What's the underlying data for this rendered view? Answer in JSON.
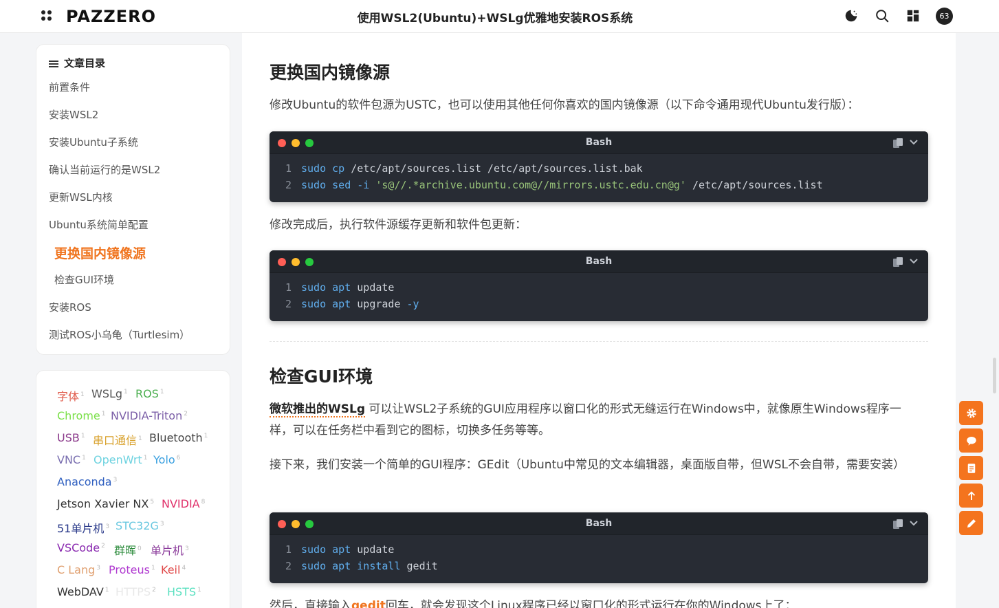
{
  "header": {
    "logo": "PAZZERO",
    "title": "使用WSL2(Ubuntu)+WSLg优雅地安装ROS系统",
    "avatar_text": "63"
  },
  "toc": {
    "title": "文章目录",
    "items": [
      {
        "label": "前置条件"
      },
      {
        "label": "安装WSL2"
      },
      {
        "label": "安装Ubuntu子系统"
      },
      {
        "label": "确认当前运行的是WSL2"
      },
      {
        "label": "更新WSL内核"
      },
      {
        "label": "Ubuntu系统简单配置"
      },
      {
        "label": "更换国内镜像源"
      },
      {
        "label": "检查GUI环境"
      },
      {
        "label": "安装ROS"
      },
      {
        "label": "测试ROS小乌龟（Turtlesim）"
      }
    ]
  },
  "tags": [
    {
      "name": "字体",
      "count": "1",
      "color": "#e05a4a"
    },
    {
      "name": "WSLg",
      "count": "1",
      "color": "#555555"
    },
    {
      "name": "ROS",
      "count": "1",
      "color": "#4caf50"
    },
    {
      "name": "Chrome",
      "count": "1",
      "color": "#7be04a"
    },
    {
      "name": "NVIDIA-Triton",
      "count": "2",
      "color": "#7b5ea7"
    },
    {
      "name": "USB",
      "count": "1",
      "color": "#8b3a8b"
    },
    {
      "name": "串口通信",
      "count": "1",
      "color": "#d8a02a"
    },
    {
      "name": "Bluetooth",
      "count": "1",
      "color": "#444444"
    },
    {
      "name": "VNC",
      "count": "1",
      "color": "#7a6fb0"
    },
    {
      "name": "OpenWrt",
      "count": "1",
      "color": "#6fd3e0"
    },
    {
      "name": "Yolo",
      "count": "6",
      "color": "#3aa0e0"
    },
    {
      "name": "Anaconda",
      "count": "3",
      "color": "#3060c0"
    },
    {
      "name": "Jetson Xavier NX",
      "count": "5",
      "color": "#333333"
    },
    {
      "name": "NVIDIA",
      "count": "8",
      "color": "#e0306a"
    },
    {
      "name": "51单片机",
      "count": "3",
      "color": "#2a3a8a"
    },
    {
      "name": "STC32G",
      "count": "3",
      "color": "#6ac8e0"
    },
    {
      "name": "VSCode",
      "count": "2",
      "color": "#8a2ab0"
    },
    {
      "name": "群晖",
      "count": "0",
      "color": "#2a8a3a"
    },
    {
      "name": "单片机",
      "count": "3",
      "color": "#8a3a9a"
    },
    {
      "name": "C Lang",
      "count": "3",
      "color": "#e0a070"
    },
    {
      "name": "Proteus",
      "count": "1",
      "color": "#b03ad0"
    },
    {
      "name": "Keil",
      "count": "4",
      "color": "#e04a4a"
    },
    {
      "name": "WebDAV",
      "count": "1",
      "color": "#333333"
    },
    {
      "name": "HTTPS",
      "count": "2",
      "color": "#e8e8e8"
    },
    {
      "name": "HSTS",
      "count": "1",
      "color": "#5ae0c0"
    }
  ],
  "article": {
    "section1_title": "更换国内镜像源",
    "section1_para": "修改Ubuntu的软件包源为USTC，也可以使用其他任何你喜欢的国内镜像源（以下命令通用现代Ubuntu发行版）：",
    "after_block1": "修改完成后，执行软件源缓存更新和软件包更新：",
    "section2_title": "检查GUI环境",
    "section2_link": "微软推出的WSLg",
    "section2_para": "可以让WSL2子系统的GUI应用程序以窗口化的形式无缝运行在Windows中，就像原生Windows程序一样，可以在任务栏中看到它的图标，切换多任务等等。",
    "section2_para2": "接下来，我们安装一个简单的GUI程序：GEdit（Ubuntu中常见的文本编辑器，桌面版自带，但WSL不会自带，需要安装）",
    "bottom_pre": "然后，直接输入",
    "bottom_kw": "gedit",
    "bottom_post": "回车，就会发现这个Linux程序已经以窗口化的形式运行在你的Windows上了：",
    "code_lang": "Bash",
    "block1": {
      "line1": {
        "no": "1",
        "cmd": "sudo cp",
        "rest": " /etc/apt/sources.list /etc/apt/sources.list.bak"
      },
      "line2": {
        "no": "2",
        "cmd": "sudo sed -i",
        "str": "'s@//.*archive.ubuntu.com@//mirrors.ustc.edu.cn@g'",
        "rest": " /etc/apt/sources.list"
      }
    },
    "block2": {
      "line1": {
        "no": "1",
        "cmd": "sudo apt",
        "rest": " update"
      },
      "line2": {
        "no": "2",
        "cmd": "sudo apt",
        "rest": " upgrade",
        "flag": " -y"
      }
    },
    "block3": {
      "line1": {
        "no": "1",
        "cmd": "sudo apt",
        "rest": " update"
      },
      "line2": {
        "no": "2",
        "cmd": "sudo apt install",
        "rest": " gedit"
      }
    }
  },
  "colors": {
    "accent": "#f0741e",
    "code_bg": "#282c34"
  }
}
